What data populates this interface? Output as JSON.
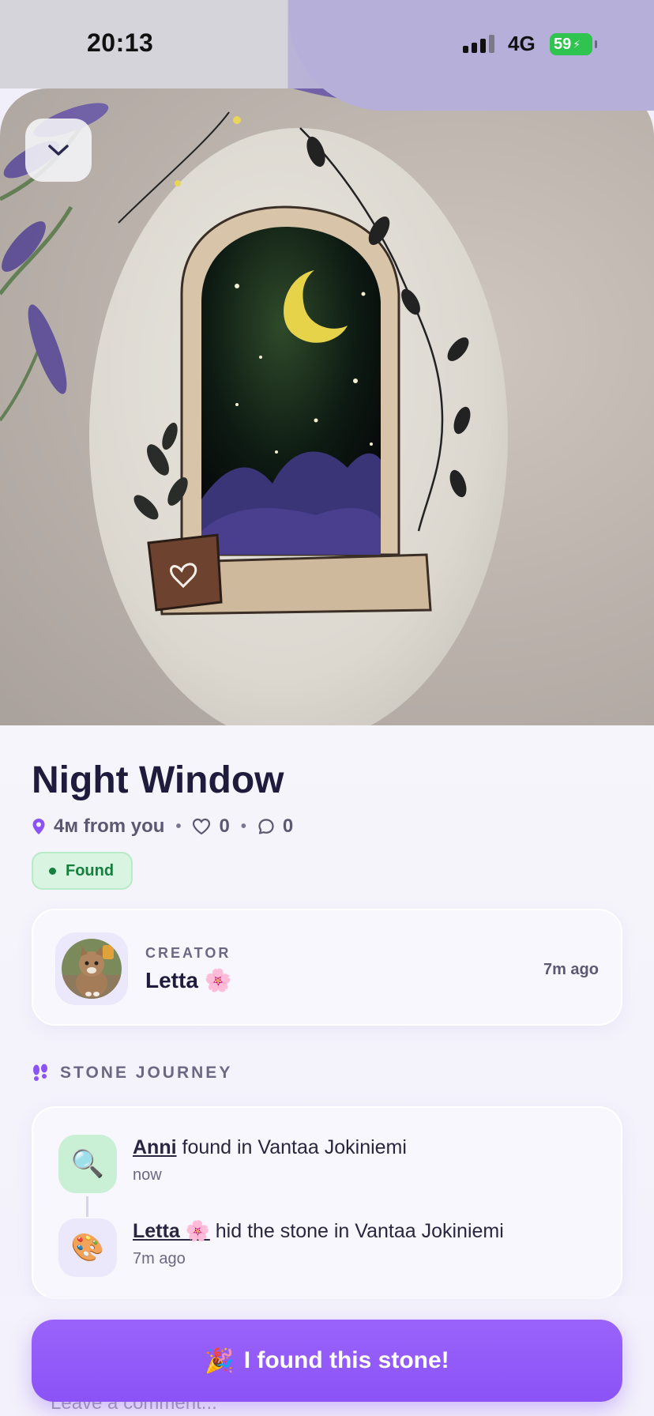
{
  "status_bar": {
    "time": "20:13",
    "network": "4G",
    "battery": "59",
    "battery_charging": true
  },
  "photo": {
    "icon": "collapse-chevron-down-icon"
  },
  "stone": {
    "title": "Night Window",
    "distance": "4м from you",
    "likes": "0",
    "comments": "0",
    "status": "Found",
    "status_color": "#15803d"
  },
  "creator": {
    "label": "CREATOR",
    "name": "Letta 🌸",
    "time": "7m ago"
  },
  "journey": {
    "header": "STONE JOURNEY",
    "items": [
      {
        "icon": "🔍",
        "who": "Anni",
        "action": " found in Vantaa Jokiniemi",
        "time": "now"
      },
      {
        "icon": "🎨",
        "who": "Letta 🌸",
        "action": " hid the stone in Vantaa Jokiniemi",
        "time": "7m ago"
      }
    ]
  },
  "cta": {
    "emoji": "🎉",
    "label": "I found this stone!"
  },
  "comment": {
    "placeholder": "Leave a comment..."
  },
  "colors": {
    "accent": "#8b53f6",
    "found_bg": "#d9f5e2"
  }
}
